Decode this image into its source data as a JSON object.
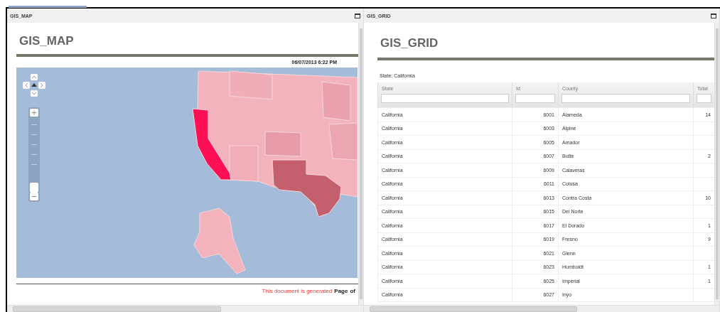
{
  "map_panel": {
    "title": "GIS_MAP",
    "heading": "GIS_MAP",
    "timestamp": "06/07/2013  6:22 PM",
    "zoom": {
      "level": 0.1
    },
    "footer": {
      "notice": "This document is generated",
      "page_label": "Page",
      "of_label": "of"
    }
  },
  "grid_panel": {
    "title": "GIS_GRID",
    "heading": "GIS_GRID",
    "filter_label": "State: California",
    "columns": [
      "State",
      "Id",
      "County",
      "Total"
    ],
    "rows": [
      {
        "state": "California",
        "id": "6001",
        "county": "Alameda",
        "total": "14"
      },
      {
        "state": "California",
        "id": "6003",
        "county": "Alpine"
      },
      {
        "state": "California",
        "id": "6005",
        "county": "Amador"
      },
      {
        "state": "California",
        "id": "6007",
        "county": "Butte",
        "total": "2"
      },
      {
        "state": "California",
        "id": "6009",
        "county": "Calaveras"
      },
      {
        "state": "California",
        "id": "6011",
        "county": "Colusa"
      },
      {
        "state": "California",
        "id": "6013",
        "county": "Contra Costa",
        "total": "10"
      },
      {
        "state": "California",
        "id": "6015",
        "county": "Del Norte"
      },
      {
        "state": "California",
        "id": "6017",
        "county": "El Dorado",
        "total": "1"
      },
      {
        "state": "California",
        "id": "6019",
        "county": "Fresno",
        "total": "9"
      },
      {
        "state": "California",
        "id": "6021",
        "county": "Glenn"
      },
      {
        "state": "California",
        "id": "6023",
        "county": "Humboldt",
        "total": "1"
      },
      {
        "state": "California",
        "id": "6025",
        "county": "Imperial",
        "total": "1"
      },
      {
        "state": "California",
        "id": "6027",
        "county": "Inyo"
      }
    ]
  }
}
